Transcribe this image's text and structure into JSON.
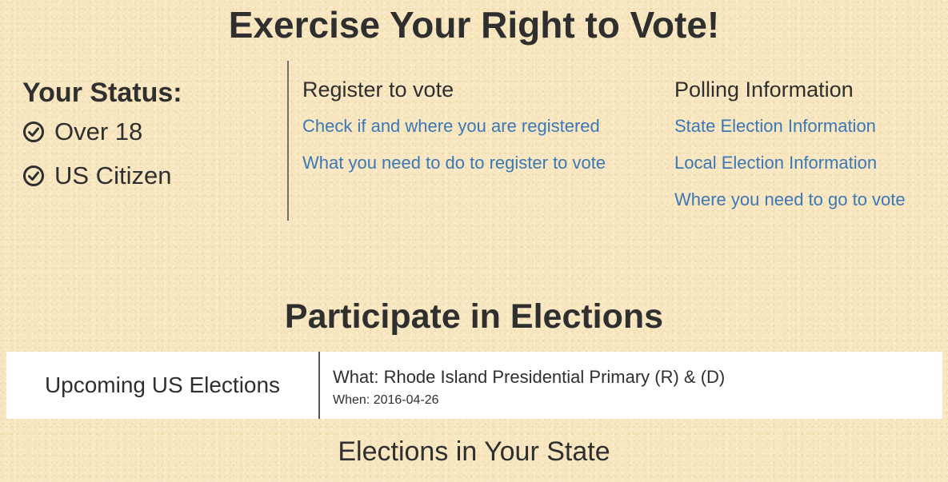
{
  "page": {
    "title": "Exercise Your Right to Vote!"
  },
  "status": {
    "heading": "Your Status:",
    "items": [
      {
        "label": "Over 18",
        "icon": "check-circle-icon"
      },
      {
        "label": "US Citizen",
        "icon": "check-circle-icon"
      }
    ]
  },
  "register": {
    "heading": "Register to vote",
    "links": [
      "Check if and where you are registered",
      "What you need to do to register to vote"
    ]
  },
  "polling": {
    "heading": "Polling Information",
    "links": [
      "State Election Information",
      "Local Election Information",
      "Where you need to go to vote"
    ]
  },
  "participate": {
    "title": "Participate in Elections",
    "upcoming_label": "Upcoming US Elections",
    "election": {
      "what": "What: Rhode Island Presidential Primary (R) & (D)",
      "when": "When: 2016-04-26"
    }
  },
  "state_section": {
    "title": "Elections in Your State"
  },
  "colors": {
    "link": "#3a78b7",
    "text": "#2f2f2f",
    "background": "#f7e6bf"
  }
}
